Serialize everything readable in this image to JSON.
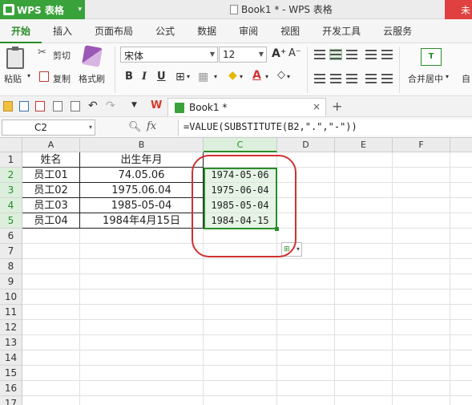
{
  "titlebar": {
    "app_name": "WPS 表格",
    "doc_title": "Book1 * - WPS 表格",
    "right_label": "未"
  },
  "tabs": [
    "开始",
    "插入",
    "页面布局",
    "公式",
    "数据",
    "审阅",
    "视图",
    "开发工具",
    "云服务"
  ],
  "ribbon": {
    "paste": "粘贴",
    "cut": "剪切",
    "copy": "复制",
    "format_painter": "格式刷",
    "font_name": "宋体",
    "font_size": "12",
    "bold": "B",
    "italic": "I",
    "underline": "U",
    "merge_center": "合并居中",
    "auto": "自"
  },
  "doc_tab": {
    "label": "Book1 *",
    "close": "×",
    "add": "+"
  },
  "formula_bar": {
    "cell_ref": "C2",
    "fx": "fx",
    "formula": "=VALUE(SUBSTITUTE(B2,\".\",\"-\"))"
  },
  "columns": [
    "A",
    "B",
    "C",
    "D",
    "E",
    "F"
  ],
  "rows": [
    "1",
    "2",
    "3",
    "4",
    "5",
    "6",
    "7",
    "8",
    "9",
    "10",
    "11",
    "12",
    "13",
    "14",
    "15",
    "16",
    "17"
  ],
  "table": {
    "headers": [
      "姓名",
      "出生年月"
    ],
    "data": [
      {
        "name": "员工01",
        "birth": "74.05.06",
        "converted": "1974-05-06"
      },
      {
        "name": "员工02",
        "birth": "1975.06.04",
        "converted": "1975-06-04"
      },
      {
        "name": "员工03",
        "birth": "1985-05-04",
        "converted": "1985-05-04"
      },
      {
        "name": "员工04",
        "birth": "1984年4月15日",
        "converted": "1984-04-15"
      }
    ]
  },
  "colors": {
    "accent": "#2a8c2a",
    "annotation": "#d23030",
    "app": "#3aa23a"
  }
}
